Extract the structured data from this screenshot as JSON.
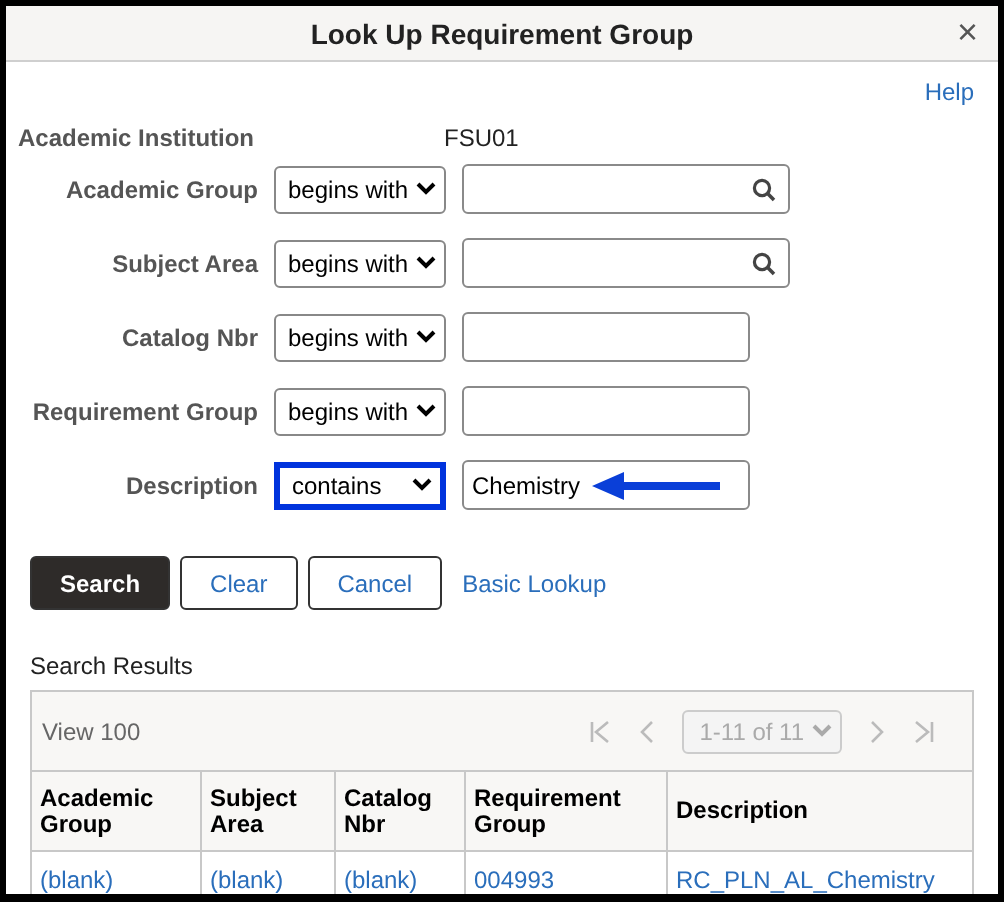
{
  "window": {
    "title": "Look Up Requirement Group",
    "close": "×"
  },
  "help": "Help",
  "institution": {
    "label": "Academic Institution",
    "value": "FSU01"
  },
  "fields": [
    {
      "label": "Academic Group",
      "operator": "begins with",
      "kind": "lookup",
      "focused": false,
      "arrow": false
    },
    {
      "label": "Subject Area",
      "operator": "begins with",
      "kind": "lookup",
      "focused": false,
      "arrow": false
    },
    {
      "label": "Catalog Nbr",
      "operator": "begins with",
      "kind": "plain",
      "focused": false,
      "arrow": false
    },
    {
      "label": "Requirement Group",
      "operator": "begins with",
      "kind": "plain",
      "focused": false,
      "arrow": false
    },
    {
      "label": "Description",
      "operator": "contains",
      "kind": "plain",
      "value": "Chemistry",
      "focused": true,
      "arrow": true
    }
  ],
  "buttons": [
    {
      "label": "Search",
      "kind": "primary"
    },
    {
      "label": "Clear",
      "kind": "secondary"
    },
    {
      "label": "Cancel",
      "kind": "secondary"
    },
    {
      "label": "Basic Lookup",
      "kind": "link"
    }
  ],
  "results": {
    "title": "Search Results",
    "view": "View 100",
    "pager": "1-11 of 11",
    "columns": [
      "Academic Group",
      "Subject Area",
      "Catalog Nbr",
      "Requirement Group",
      "Description"
    ],
    "rows": [
      [
        "(blank)",
        "(blank)",
        "(blank)",
        "004993",
        "RC_PLN_AL_Chemistry"
      ]
    ]
  }
}
